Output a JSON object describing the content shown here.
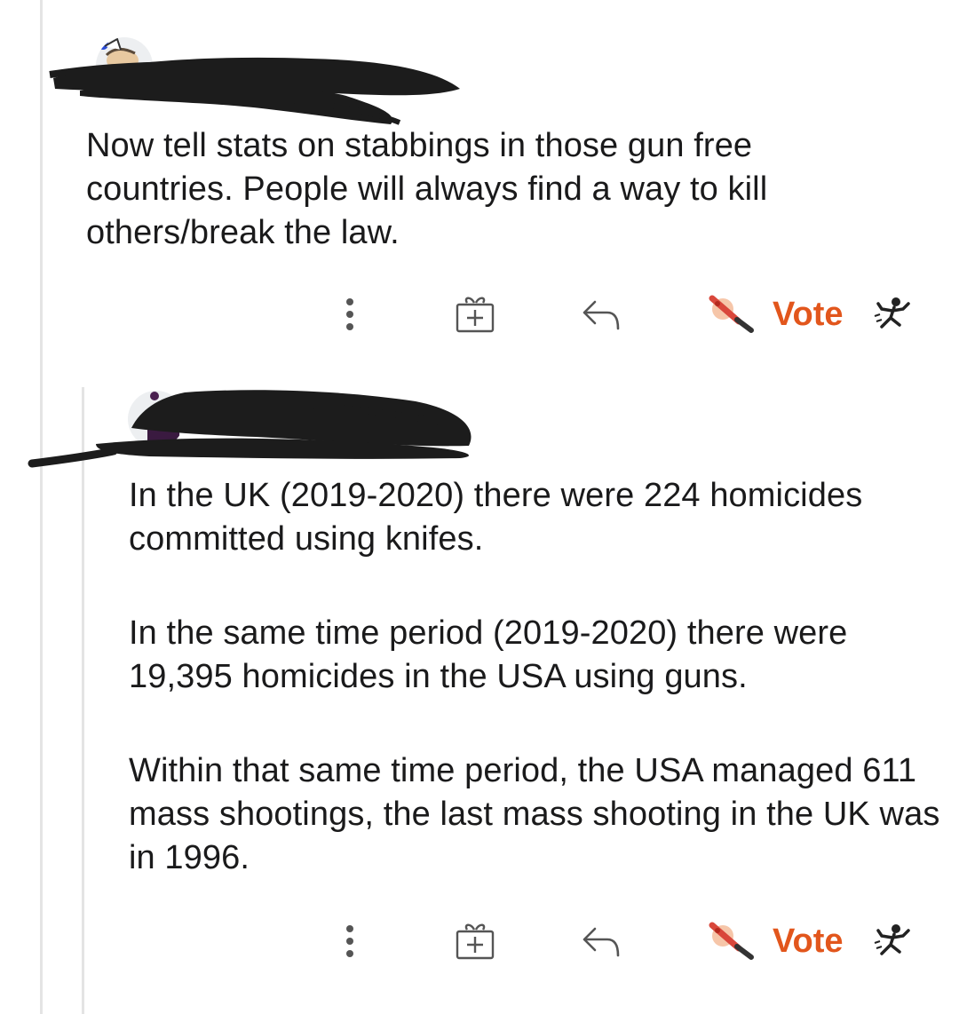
{
  "colors": {
    "vote_accent": "#e2561c",
    "thread_line": "#e4e4e4",
    "text": "#1a1a1b",
    "redaction": "#1c1c1c"
  },
  "comments": [
    {
      "username": "",
      "avatar": "snoo-avatar-blue",
      "body": [
        "Now tell stats on stabbings in those gun free countries. People will always find a way to kill others/break the law."
      ],
      "actions": {
        "more_icon": "vertical-dots-icon",
        "award_icon": "gift-icon",
        "reply_icon": "reply-arrow-icon",
        "upvote_icon": "knife-upvote-icon",
        "vote_label": "Vote",
        "downvote_icon": "fleeing-figure-downvote-icon"
      }
    },
    {
      "username": "",
      "avatar": "snoo-avatar-purple",
      "body": [
        "In the UK (2019-2020) there were 224 homicides committed using knifes.",
        "In the same time period (2019-2020) there were 19,395 homicides in the USA using guns.",
        "Within that same time period, the USA managed 611 mass shootings, the last mass shooting in the UK was in 1996."
      ],
      "actions": {
        "more_icon": "vertical-dots-icon",
        "award_icon": "gift-icon",
        "reply_icon": "reply-arrow-icon",
        "upvote_icon": "knife-upvote-icon",
        "vote_label": "Vote",
        "downvote_icon": "fleeing-figure-downvote-icon"
      }
    }
  ]
}
